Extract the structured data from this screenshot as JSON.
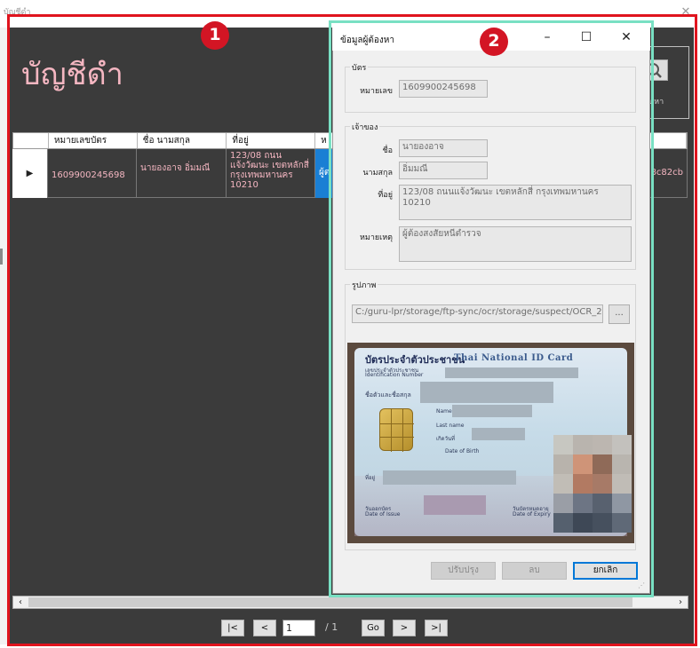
{
  "window": {
    "title": "บัญชีดำ"
  },
  "app": {
    "title": "บัญชีดำ",
    "search_label": "ค้นหา"
  },
  "grid": {
    "columns": [
      "",
      "หมายเลขบัตร",
      "ชื่อ นามสกุล",
      "ที่อยู่",
      "ห",
      "",
      "",
      "",
      ""
    ],
    "row": {
      "card_number": "1609900245698",
      "name": "นายองอาจ อิ่มมณี",
      "address": "123/08 ถนนแจ้งวัฒนะ เขตหลักสี่ กรุงเทพมหานคร 10210",
      "note_partial": "ผู้ต",
      "id_partial": "9a8c82cb"
    }
  },
  "pager": {
    "first": "|<",
    "prev": "<",
    "page": "1",
    "of": "/ 1",
    "go": "Go",
    "next": ">",
    "last": ">|"
  },
  "badges": {
    "one": "1",
    "two": "2"
  },
  "dialog": {
    "title": "ข้อมูลผู้ต้องหา",
    "card_group": "บัตร",
    "card_number_label": "หมายเลข",
    "card_number": "1609900245698",
    "owner_group": "เจ้าของ",
    "first_name_label": "ชื่อ",
    "first_name": "นายองอาจ",
    "last_name_label": "นามสกุล",
    "last_name": "อิ่มมณี",
    "address_label": "ที่อยู่",
    "address": "123/08 ถนนแจ้งวัฒนะ เขตหลักสี่ กรุงเทพมหานคร 10210",
    "note_label": "หมายเหตุ",
    "note": "ผู้ต้องสงสัยหนีตำรวจ",
    "image_group": "รูปภาพ",
    "image_path": "C:/guru-lpr/storage/ftp-sync/ocr/storage/suspect/OCR_2",
    "browse_label": "...",
    "update_button": "ปรับปรุง",
    "delete_button": "ลบ",
    "cancel_button": "ยกเลิก"
  },
  "id_card": {
    "title_th": "บัตรประจำตัวประชาชน",
    "title_en": "Thai National ID Card",
    "id_label": "เลขประจำตัวประชาชน",
    "id_label_en": "Identification Number",
    "name_label": "ชื่อตัวและชื่อสกุล",
    "name_en": "Name",
    "last_name_en": "Last name",
    "dob_label": "เกิดวันที่",
    "dob_en": "Date of Birth",
    "address_label": "ที่อยู่",
    "issue_label": "วันออกบัตร",
    "issue_en": "Date of Issue",
    "expiry_label": "วันบัตรหมดอายุ",
    "expiry_en": "Date of Expiry"
  },
  "colors": {
    "frame": "#e0141e",
    "dialog_outline": "#79e0c3",
    "title_pink": "#f4b6c1",
    "selected": "#1a7fd4",
    "badge": "#d31524"
  }
}
